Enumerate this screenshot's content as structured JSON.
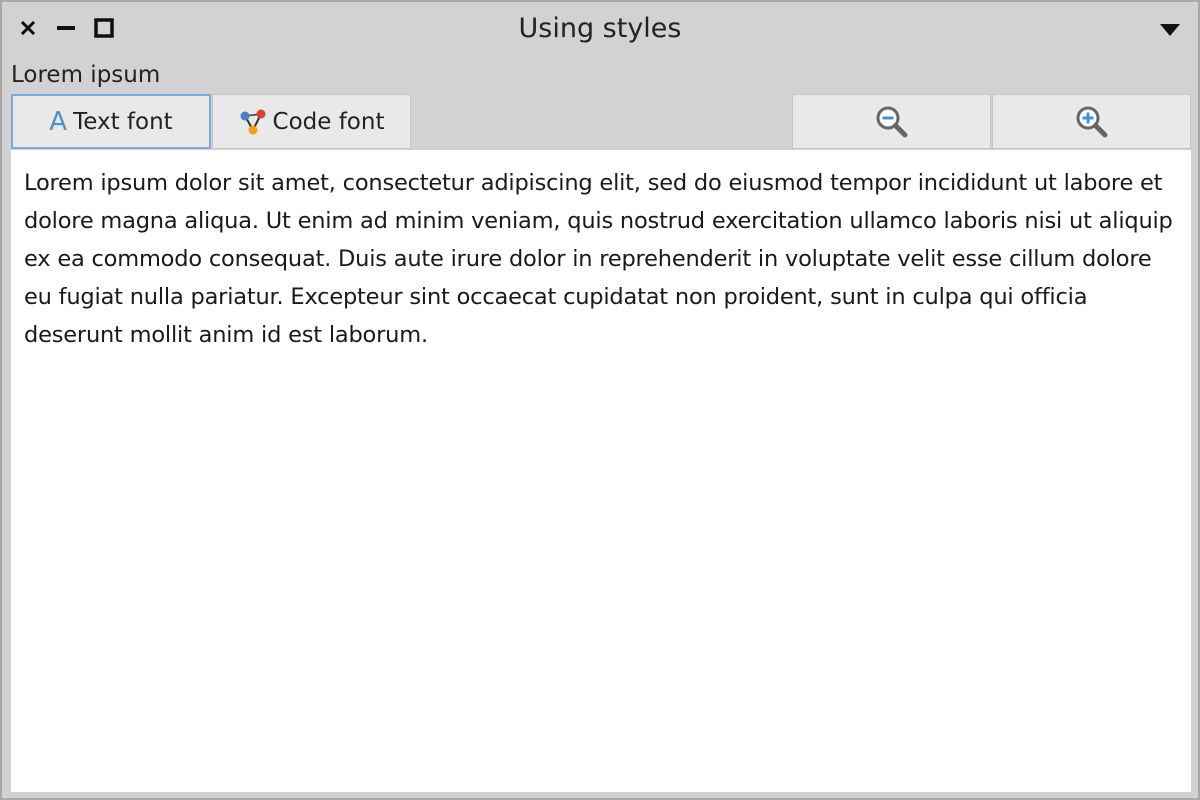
{
  "window": {
    "title": "Using styles"
  },
  "section": {
    "label": "Lorem ipsum"
  },
  "toolbar": {
    "text_font_label": "Text font",
    "code_font_label": "Code font",
    "zoom_out_icon": "zoom-out-icon",
    "zoom_in_icon": "zoom-in-icon"
  },
  "content": {
    "text": "Lorem ipsum dolor sit amet, consectetur adipiscing elit, sed do eiusmod tempor incididunt ut labore et dolore magna aliqua. Ut enim ad minim veniam, quis nostrud exercitation ullamco laboris nisi ut aliquip ex ea commodo consequat. Duis aute irure dolor in reprehenderit in voluptate velit esse cillum dolore eu fugiat nulla pariatur. Excepteur sint occaecat cupidatat non proident, sunt in culpa qui officia deserunt mollit anim id est laborum."
  },
  "colors": {
    "selected_border": "#7aaad6",
    "text_icon": "#4f8fc9",
    "background": "#d2d2d2"
  }
}
